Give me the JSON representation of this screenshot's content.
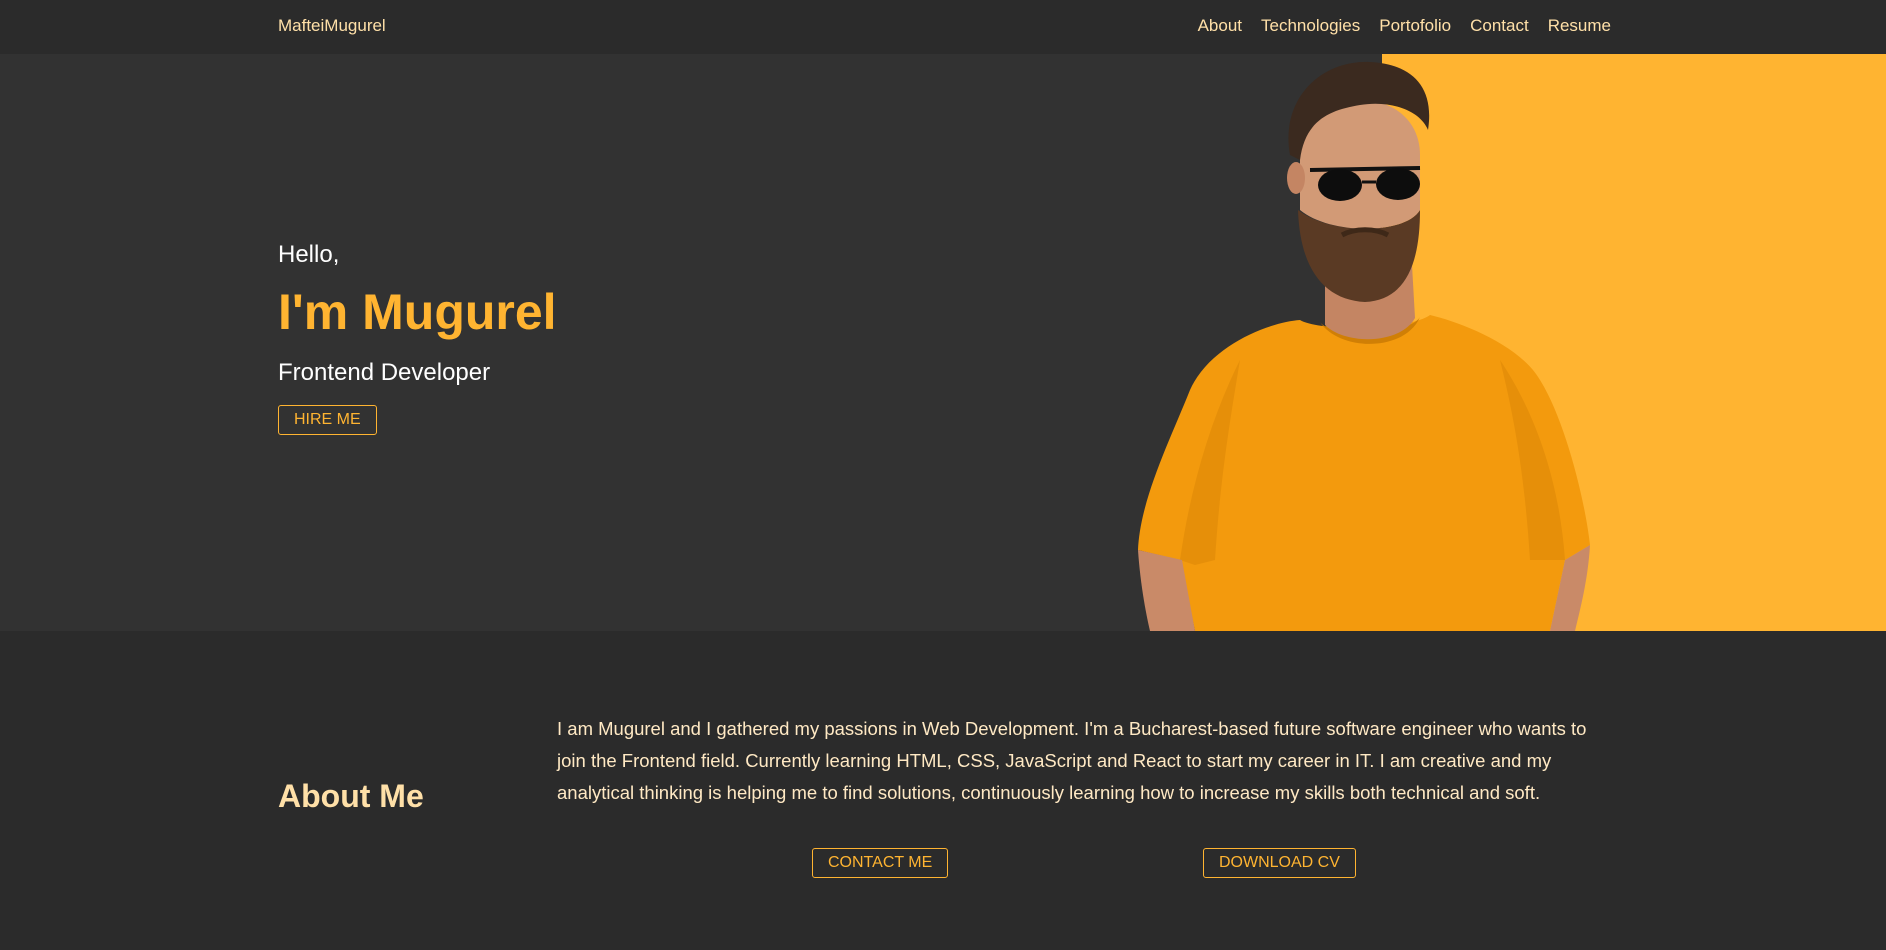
{
  "nav": {
    "brand": "MafteiMugurel",
    "links": [
      "About",
      "Technologies",
      "Portofolio",
      "Contact",
      "Resume"
    ]
  },
  "hero": {
    "greeting": "Hello,",
    "name": "I'm Mugurel",
    "role": "Frontend Developer",
    "hire_label": "HIRE ME"
  },
  "about": {
    "title": "About Me",
    "paragraph": "I am Mugurel and I gathered my passions in Web Development. I'm a Bucharest-based future software engineer who wants to join the Frontend field. Currently learning HTML, CSS, JavaScript and React to start my career in IT. I am creative and my analytical thinking is helping me to find solutions, continuously learning how to increase my skills both technical and soft.",
    "contact_label": "CONTACT ME",
    "cv_label": "DOWNLOAD CV"
  },
  "colors": {
    "accent": "#ffb431",
    "background": "#323232",
    "navbar": "#2b2b2b",
    "link_text": "#ffe0a8"
  },
  "icons": {
    "portrait": "person-portrait"
  }
}
